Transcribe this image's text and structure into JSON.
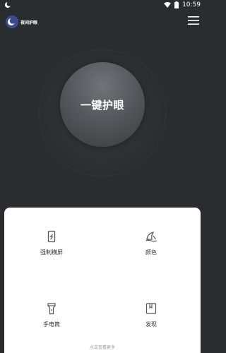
{
  "status_bar": {
    "time": "10:59"
  },
  "header": {
    "logo_text": "夜间护眼"
  },
  "main": {
    "eye_button_label": "一键护眼"
  },
  "features": [
    {
      "label": "强制横屏",
      "icon": "phone-rotate-icon"
    },
    {
      "label": "颜色",
      "icon": "shark-fin-icon"
    },
    {
      "label": "手电筒",
      "icon": "flashlight-icon"
    },
    {
      "label": "发现",
      "icon": "bookmark-book-icon"
    }
  ],
  "footer": {
    "more_text": "点击查看更多"
  },
  "colors": {
    "background": "#2a2d30",
    "panel": "#ffffff",
    "logo_blue": "#3d4b8e"
  }
}
